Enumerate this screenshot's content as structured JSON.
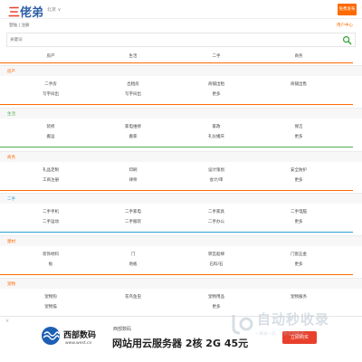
{
  "header": {
    "logo_part1": "三",
    "logo_part2": "佬弟",
    "city": "北京 ∨",
    "publish_label": "免费发布"
  },
  "subbar": {
    "login_links": "登陆 | 注册",
    "user_center": "用户中心"
  },
  "search": {
    "placeholder": "关键词"
  },
  "top_categories": [
    "房产",
    "生活",
    "二手",
    "商务"
  ],
  "sections": [
    {
      "title": "房产",
      "accent": "#ff6a00",
      "rows": [
        [
          "二手房",
          "出租房",
          "商铺出租",
          "商铺出售"
        ],
        [
          "写字间出",
          "写字间出",
          "更多",
          ""
        ]
      ]
    },
    {
      "title": "生活",
      "accent": "#4caf50",
      "rows": [
        [
          "装修",
          "家电维修",
          "家政",
          "保洁"
        ],
        [
          "搬运",
          "搬家",
          "礼仪婚庆",
          "更多"
        ]
      ]
    },
    {
      "title": "商务",
      "accent": "#ff6a00",
      "rows": [
        [
          "礼品定制",
          "印刷",
          "设计策划",
          "安全防护"
        ],
        [
          "工商注册",
          "律师",
          "会计/审",
          "更多"
        ]
      ]
    },
    {
      "title": "二手",
      "accent": "#2aa0d4",
      "rows": [
        [
          "二手手机",
          "二手家电",
          "二手家具",
          "二手电脑"
        ],
        [
          "二手运动",
          "二手服装",
          "二手办公",
          "更多"
        ]
      ]
    },
    {
      "title": "建材",
      "accent": "#ff6a00",
      "rows": [
        [
          "装饰材料",
          "门",
          "转瓦船梯",
          "门窗五金"
        ],
        [
          "板",
          "地板",
          "石料/石",
          "更多"
        ]
      ]
    },
    {
      "title": "宠物",
      "accent": "#ff6a00",
      "rows": [
        [
          "宠物狗",
          "花鸟鱼虫",
          "宠物用品",
          "宠物服务"
        ],
        [
          "宠物猫",
          "",
          "更多",
          ""
        ]
      ]
    }
  ],
  "ad": {
    "close": "×",
    "brand": "西部数码",
    "brand_url": "www.west.cn",
    "small_text": "西部数码",
    "headline": "网站用云服务器 2核 2G 45元",
    "button": "立即购买"
  },
  "watermark": {
    "text": "自动秒收录",
    "sub": "一来访一次，一秒自动收录一"
  }
}
